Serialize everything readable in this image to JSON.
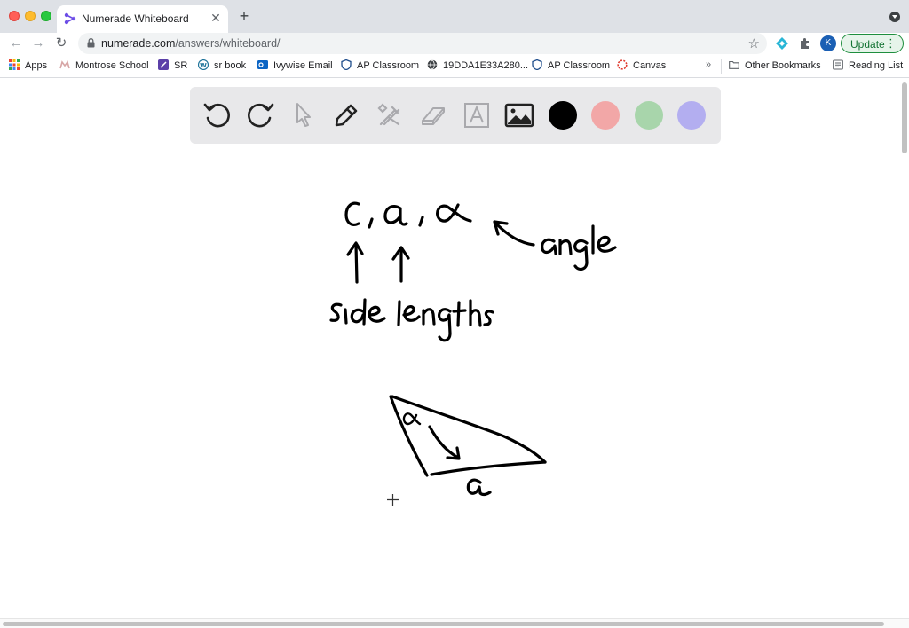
{
  "tab": {
    "title": "Numerade Whiteboard",
    "close": "✕",
    "new_tab": "+"
  },
  "toolbar": {
    "back": "←",
    "forward": "→",
    "reload": "↻",
    "url_host": "numerade.com",
    "url_path": "/answers/whiteboard/",
    "star": "☆",
    "profile_initial": "K",
    "update_label": "Update",
    "update_menu": "⋮"
  },
  "bookmarks": {
    "items": [
      {
        "label": "Apps",
        "icon": "apps-grid-icon",
        "color": "#e8453c"
      },
      {
        "label": "Montrose School",
        "icon": "montrose-icon",
        "color": "#d7a6a6"
      },
      {
        "label": "SR",
        "icon": "sr-icon",
        "color": "#5b3fa8"
      },
      {
        "label": "sr book",
        "icon": "wordpress-icon",
        "color": "#21759b"
      },
      {
        "label": "Ivywise Email",
        "icon": "outlook-icon",
        "color": "#0a64c4"
      },
      {
        "label": "AP Classroom",
        "icon": "shield-icon",
        "color": "#1f4e8c"
      },
      {
        "label": "19DDA1E33A280...",
        "icon": "globe-icon",
        "color": "#3c4043"
      },
      {
        "label": "AP Classroom",
        "icon": "shield-icon",
        "color": "#1f4e8c"
      },
      {
        "label": "Canvas",
        "icon": "canvas-icon",
        "color": "#e03a2e"
      }
    ],
    "overflow": "»",
    "other_bookmarks": "Other Bookmarks",
    "reading_list": "Reading List"
  },
  "whiteboard": {
    "tools": [
      {
        "name": "undo-icon",
        "enabled": true
      },
      {
        "name": "redo-icon",
        "enabled": true
      },
      {
        "name": "select-pointer-icon",
        "enabled": false
      },
      {
        "name": "pen-icon",
        "enabled": true
      },
      {
        "name": "shapes-tools-icon",
        "enabled": false
      },
      {
        "name": "eraser-icon",
        "enabled": false
      },
      {
        "name": "text-icon",
        "enabled": false
      },
      {
        "name": "image-icon",
        "enabled": true
      }
    ],
    "colors": [
      "#000000",
      "#f2a7a7",
      "#a8d5ab",
      "#b3aef0"
    ],
    "selected_color": "#000000"
  },
  "handwriting": {
    "variables": "c, a, α",
    "label_angle": "angle",
    "label_side_lengths": "side lengths",
    "triangle_angle_label": "α",
    "triangle_side_label": "a"
  }
}
